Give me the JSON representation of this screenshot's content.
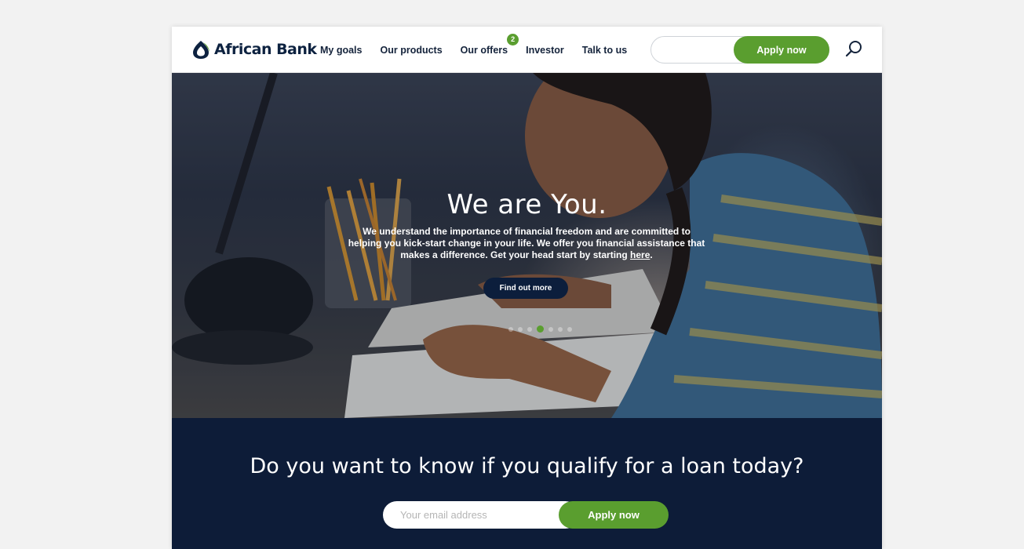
{
  "brand": {
    "name": "African Bank",
    "color": "#0d2240",
    "accent": "#5a9e2f"
  },
  "nav": {
    "items": [
      {
        "label": "My goals"
      },
      {
        "label": "Our products"
      },
      {
        "label": "Our offers",
        "badge": "2"
      },
      {
        "label": "Investor"
      },
      {
        "label": "Talk to us"
      }
    ],
    "apply_label": "Apply now",
    "search_icon": "search-icon"
  },
  "hero": {
    "title": "We are You.",
    "body": "We understand the importance of financial freedom and are committed to helping you kick-start change in your life. We offer you financial assistance that makes a difference. Get your head start by starting ",
    "link": "here",
    "body_end": ".",
    "button": "Find out more",
    "slides": 7,
    "active_slide": 3
  },
  "cta": {
    "title": "Do you want to know if you qualify for a loan today?",
    "email_placeholder": "Your email address",
    "apply_label": "Apply now",
    "background": "#0d1c38"
  }
}
